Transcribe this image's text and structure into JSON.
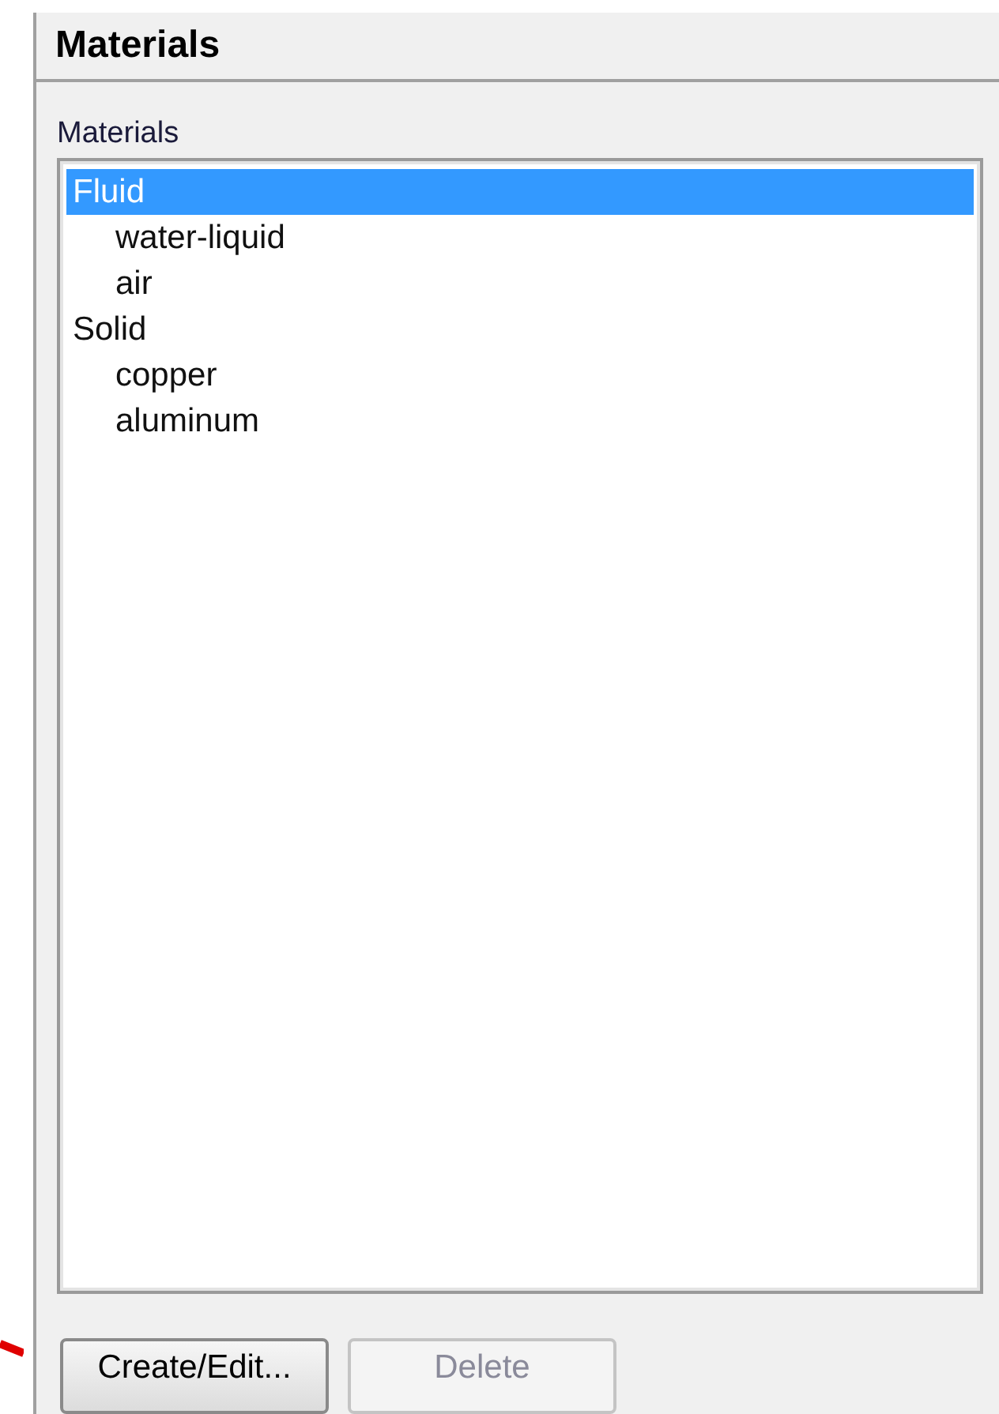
{
  "panel": {
    "title": "Materials"
  },
  "materials": {
    "label": "Materials",
    "tree": [
      {
        "label": "Fluid",
        "selected": true,
        "children": [
          {
            "label": "water-liquid",
            "selected": false
          },
          {
            "label": "air",
            "selected": false
          }
        ]
      },
      {
        "label": "Solid",
        "selected": false,
        "children": [
          {
            "label": "copper",
            "selected": false
          },
          {
            "label": "aluminum",
            "selected": false
          }
        ]
      }
    ]
  },
  "buttons": [
    {
      "label": "Create/Edit...",
      "disabled": false
    },
    {
      "label": "Delete",
      "disabled": true
    }
  ]
}
